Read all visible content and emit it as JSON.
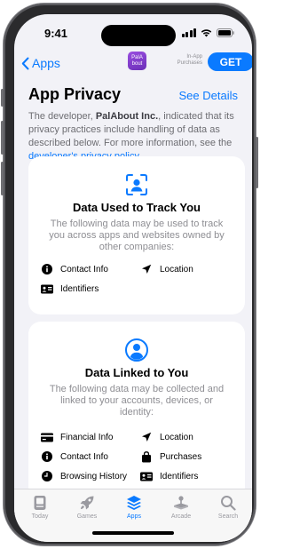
{
  "status_bar": {
    "time": "9:41"
  },
  "nav": {
    "back_label": "Apps",
    "app_icon_text": "PalAbout",
    "in_app_purchases": "In-App Purchases",
    "get_label": "GET"
  },
  "header": {
    "title": "App Privacy",
    "see_details": "See Details"
  },
  "description": {
    "prefix": "The developer, ",
    "developer": "PalAbout Inc.",
    "middle": ", indicated that its privacy practices include handling of data as described below. For more information, see the ",
    "link": "developer's privacy policy",
    "suffix": "."
  },
  "cards": [
    {
      "title": "Data Used to Track You",
      "subtitle": "The following data may be used to track you across apps and websites owned by other companies:",
      "icon": "tracking-icon",
      "items": [
        {
          "label": "Contact Info",
          "icon": "info-icon"
        },
        {
          "label": "Location",
          "icon": "location-icon"
        },
        {
          "label": "Identifiers",
          "icon": "id-card-icon"
        }
      ]
    },
    {
      "title": "Data Linked to You",
      "subtitle": "The following data may be collected and linked to your accounts, devices, or identity:",
      "icon": "person-icon",
      "items": [
        {
          "label": "Financial Info",
          "icon": "credit-card-icon"
        },
        {
          "label": "Location",
          "icon": "location-icon"
        },
        {
          "label": "Contact Info",
          "icon": "info-icon"
        },
        {
          "label": "Purchases",
          "icon": "shopping-bag-icon"
        },
        {
          "label": "Browsing History",
          "icon": "clock-icon"
        },
        {
          "label": "Identifiers",
          "icon": "id-card-icon"
        }
      ]
    }
  ],
  "tab_bar": {
    "tabs": [
      {
        "label": "Today",
        "icon": "today-icon",
        "active": false
      },
      {
        "label": "Games",
        "icon": "rocket-icon",
        "active": false
      },
      {
        "label": "Apps",
        "icon": "layers-icon",
        "active": true
      },
      {
        "label": "Arcade",
        "icon": "joystick-icon",
        "active": false
      },
      {
        "label": "Search",
        "icon": "search-icon",
        "active": false
      }
    ]
  },
  "colors": {
    "accent": "#0a7aff",
    "background": "#f2f2f7",
    "card": "#ffffff",
    "secondary_text": "#8e8e93"
  }
}
